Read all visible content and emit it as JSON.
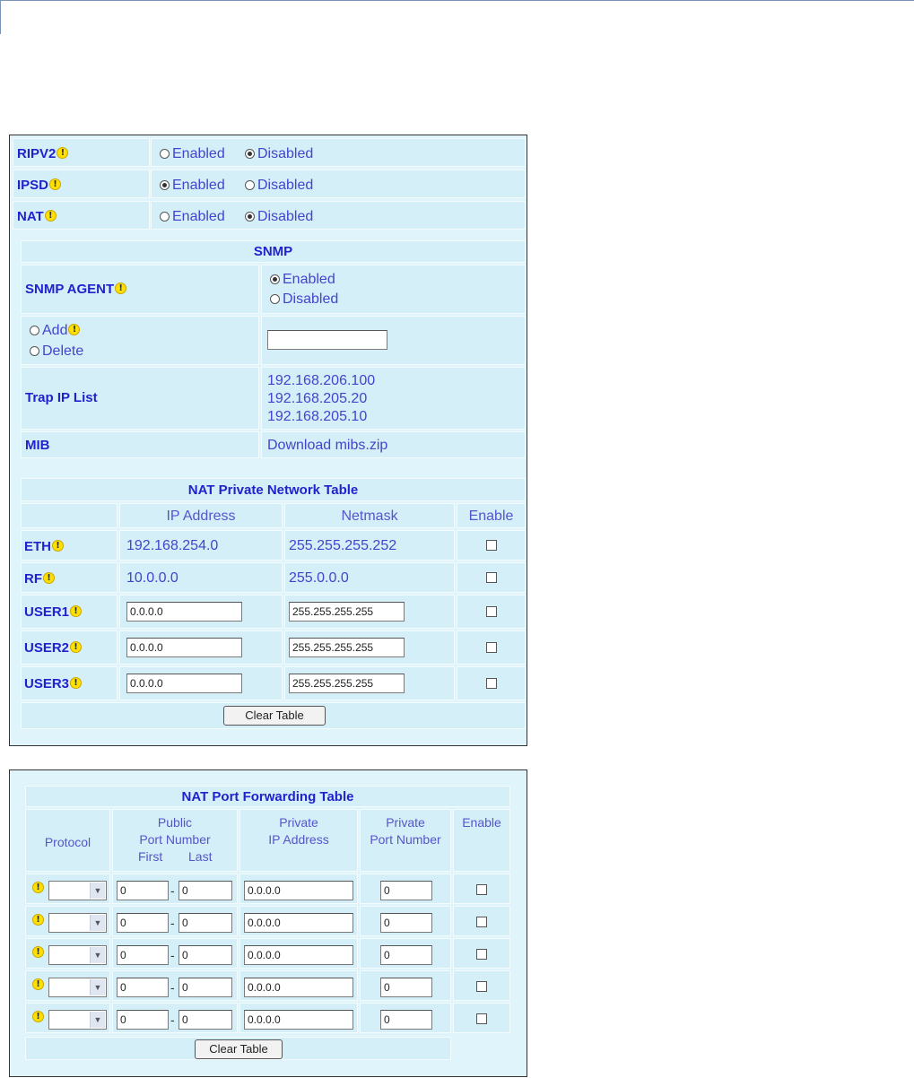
{
  "panel1": {
    "rows": [
      {
        "label": "RIPV2",
        "opt1": "Enabled",
        "opt2": "Disabled",
        "selected": "Disabled"
      },
      {
        "label": "IPSD",
        "opt1": "Enabled",
        "opt2": "Disabled",
        "selected": "Enabled"
      },
      {
        "label": "NAT",
        "opt1": "Enabled",
        "opt2": "Disabled",
        "selected": "Disabled"
      }
    ],
    "snmp": {
      "title": "SNMP",
      "agent_label": "SNMP AGENT",
      "agent_opt1": "Enabled",
      "agent_opt2": "Disabled",
      "agent_selected": "Enabled",
      "add_label": "Add",
      "delete_label": "Delete",
      "trap_input_value": "",
      "trap_label": "Trap IP List",
      "trap_ips": [
        "192.168.206.100",
        "192.168.205.20",
        "192.168.205.10"
      ],
      "mib_label": "MIB",
      "mib_link": "Download mibs.zip"
    },
    "nat_private": {
      "title": "NAT Private Network Table",
      "col_ip": "IP Address",
      "col_netmask": "Netmask",
      "col_enable": "Enable",
      "rows": [
        {
          "label": "ETH",
          "ip": "192.168.254.0",
          "netmask": "255.255.255.252",
          "editable": false,
          "enabled": false
        },
        {
          "label": "RF",
          "ip": "10.0.0.0",
          "netmask": "255.0.0.0",
          "editable": false,
          "enabled": false
        },
        {
          "label": "USER1",
          "ip": "0.0.0.0",
          "netmask": "255.255.255.255",
          "editable": true,
          "enabled": false
        },
        {
          "label": "USER2",
          "ip": "0.0.0.0",
          "netmask": "255.255.255.255",
          "editable": true,
          "enabled": false
        },
        {
          "label": "USER3",
          "ip": "0.0.0.0",
          "netmask": "255.255.255.255",
          "editable": true,
          "enabled": false
        }
      ],
      "clear_button": "Clear Table"
    }
  },
  "panel2": {
    "title": "NAT Port Forwarding Table",
    "col_protocol": "Protocol",
    "col_public_1": "Public",
    "col_public_2": "Port Number",
    "col_public_first": "First",
    "col_public_last": "Last",
    "col_private_ip_1": "Private",
    "col_private_ip_2": "IP Address",
    "col_private_port_1": "Private",
    "col_private_port_2": "Port Number",
    "col_enable": "Enable",
    "dash": "-",
    "rows": [
      {
        "protocol": "",
        "first": "0",
        "last": "0",
        "private_ip": "0.0.0.0",
        "private_port": "0",
        "enabled": false
      },
      {
        "protocol": "",
        "first": "0",
        "last": "0",
        "private_ip": "0.0.0.0",
        "private_port": "0",
        "enabled": false
      },
      {
        "protocol": "",
        "first": "0",
        "last": "0",
        "private_ip": "0.0.0.0",
        "private_port": "0",
        "enabled": false
      },
      {
        "protocol": "",
        "first": "0",
        "last": "0",
        "private_ip": "0.0.0.0",
        "private_port": "0",
        "enabled": false
      },
      {
        "protocol": "",
        "first": "0",
        "last": "0",
        "private_ip": "0.0.0.0",
        "private_port": "0",
        "enabled": false
      }
    ],
    "clear_button": "Clear Table"
  },
  "icons": {
    "warning": "warning-icon",
    "radio": "radio-button",
    "checkbox": "checkbox",
    "dropdown": "chevron-down-icon"
  },
  "colors": {
    "panel_bg": "#dff4fb",
    "cell_bg": "#d4eff8",
    "label": "#2222cc",
    "text": "#4444cc",
    "warning": "#ffe000"
  }
}
